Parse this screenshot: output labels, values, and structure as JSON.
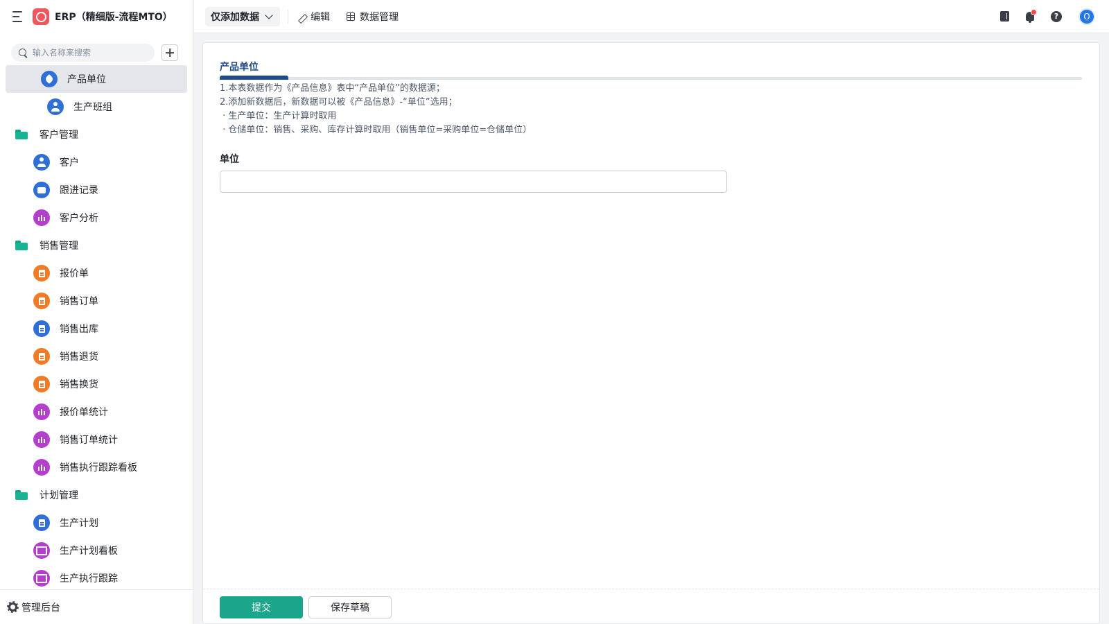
{
  "app": {
    "title": "ERP（精细版-流程MTO）"
  },
  "sidebar": {
    "search_placeholder": "输入名称来搜索",
    "items": [
      {
        "label": "产品单位",
        "kind": "item",
        "icon": "tag-icon",
        "color": "blue",
        "active": true,
        "indent": "lvl1b"
      },
      {
        "label": "生产班组",
        "kind": "item",
        "icon": "user-icon",
        "color": "blue",
        "indent": "lvl1b"
      },
      {
        "label": "客户管理",
        "kind": "group",
        "icon": "folder-icon"
      },
      {
        "label": "客户",
        "kind": "item",
        "icon": "user-icon",
        "color": "blue",
        "indent": "lvl1"
      },
      {
        "label": "跟进记录",
        "kind": "item",
        "icon": "mail-icon",
        "color": "blue",
        "indent": "lvl1"
      },
      {
        "label": "客户分析",
        "kind": "item",
        "icon": "chart-icon",
        "color": "purple",
        "indent": "lvl1"
      },
      {
        "label": "销售管理",
        "kind": "group",
        "icon": "folder-icon"
      },
      {
        "label": "报价单",
        "kind": "item",
        "icon": "doc-icon",
        "color": "orange",
        "indent": "lvl1"
      },
      {
        "label": "销售订单",
        "kind": "item",
        "icon": "doc-icon",
        "color": "orange",
        "indent": "lvl1"
      },
      {
        "label": "销售出库",
        "kind": "item",
        "icon": "doc-icon",
        "color": "blue",
        "indent": "lvl1"
      },
      {
        "label": "销售退货",
        "kind": "item",
        "icon": "doc-icon",
        "color": "orange",
        "indent": "lvl1"
      },
      {
        "label": "销售换货",
        "kind": "item",
        "icon": "doc-icon",
        "color": "orange",
        "indent": "lvl1"
      },
      {
        "label": "报价单统计",
        "kind": "item",
        "icon": "chart-icon",
        "color": "purple",
        "indent": "lvl1"
      },
      {
        "label": "销售订单统计",
        "kind": "item",
        "icon": "chart-icon",
        "color": "purple",
        "indent": "lvl1"
      },
      {
        "label": "销售执行跟踪看板",
        "kind": "item",
        "icon": "chart-icon",
        "color": "purple",
        "indent": "lvl1"
      },
      {
        "label": "计划管理",
        "kind": "group",
        "icon": "folder-icon"
      },
      {
        "label": "生产计划",
        "kind": "item",
        "icon": "doc-icon",
        "color": "blue",
        "indent": "lvl1"
      },
      {
        "label": "生产计划看板",
        "kind": "item",
        "icon": "board-icon",
        "color": "purple",
        "indent": "lvl1"
      },
      {
        "label": "生产执行跟踪",
        "kind": "item",
        "icon": "board-icon",
        "color": "purple",
        "indent": "lvl1"
      }
    ],
    "footer_label": "管理后台"
  },
  "toolbar": {
    "mode_label": "仅添加数据",
    "edit_label": "编辑",
    "data_manage_label": "数据管理",
    "avatar_letter": "O",
    "help_glyph": "?"
  },
  "form": {
    "title": "产品单位",
    "description": "1.本表数据作为《产品信息》表中“产品单位”的数据源；\n2.添加新数据后，新数据可以被《产品信息》-“单位”选用；\n · 生产单位：生产计算时取用\n · 仓储单位：销售、采购、库存计算时取用（销售单位=采购单位=仓储单位）",
    "field_label": "单位",
    "field_value": "",
    "submit_label": "提交",
    "draft_label": "保存草稿"
  },
  "colors": {
    "accent": "#19a68a",
    "title_blue": "#1f4a8c",
    "icon_blue": "#2f6fd6",
    "icon_orange": "#f07b24",
    "icon_purple": "#b53ecf"
  }
}
